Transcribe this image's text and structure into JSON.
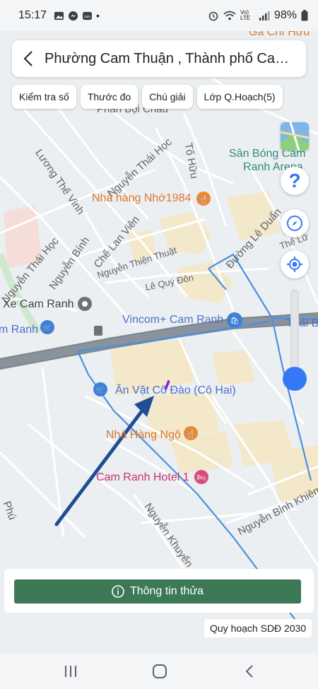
{
  "status_bar": {
    "time": "15:17",
    "battery": "98%",
    "network": "Vo) LTE",
    "icons": [
      "image-icon",
      "messenger-icon",
      "zalo-icon",
      "dot-icon",
      "alarm-icon",
      "wifi-icon",
      "signal-icon",
      "battery-icon"
    ]
  },
  "header": {
    "back_icon": "back-arrow-icon",
    "title": "Phường Cam Thuận , Thành phố Cam Ranh"
  },
  "chips": [
    {
      "label": "Kiểm tra số"
    },
    {
      "label": "Thước đo"
    },
    {
      "label": "Chú giải"
    },
    {
      "label": "Lớp Q.Hoạch(5)"
    }
  ],
  "controls": {
    "layer_icon": "map-layer-icon",
    "help_icon": "help-icon",
    "compass_icon": "compass-icon",
    "locate_icon": "my-location-icon",
    "opacity_slider_value": 0.1
  },
  "map_labels": {
    "ga_chi_huu": "Gà Chí Hữu",
    "phan_boi_chau": "Phan Bội Châu",
    "san_bong": "Sân Bóng Cam",
    "san_bong_2": "Ranh Arena",
    "to_huu": "Tố Hữu",
    "luong_the_vinh": "Lương Thế Vinh",
    "nguyen_thai_hoc_1": "Nguyễn Thái Học",
    "nhahang_nho": "Nhà hàng Nhớ1984",
    "duong_le_duan": "Đường Lê Duẩn",
    "the_lu": "Thế Lữ",
    "che_lan_vien": "Chế Lan Viên",
    "nguyen_binh": "Nguyễn Bính",
    "nguyen_thai_hoc_2": "Nguyễn Thái Học",
    "nguyen_thien_thuat": "Nguyễn Thiện Thuật",
    "le_quy_don": "Lê Quý Đôn",
    "xe_cam_ranh": "Xe Cam Ranh",
    "vincom": "Vincom+ Cam Ranh",
    "thai_bao": "Thái B",
    "cam_ranh_left": "m Ranh",
    "an_vat": "Ăn Vặt Cô Đào (Cô Hai)",
    "nha_hang_ngo": "Nhà Hàng Ngộ",
    "hotel": "Cam Ranh Hotel 1",
    "nguyen_binh_khiem": "Nguyễn Bỉnh Khiêm",
    "nguyen_khuyen": "Nguyễn Khuyến",
    "phu": "Phú"
  },
  "bottom": {
    "info_button": "Thông tin thửa",
    "info_icon": "info-icon",
    "plan_label": "Quy hoạch SDĐ 2030"
  },
  "nav": {
    "items": [
      "recents-icon",
      "home-icon",
      "back-icon"
    ]
  },
  "colors": {
    "accent": "#3478f6",
    "info_button": "#3c7a57",
    "boundary": "#4a90e2",
    "main_road": "#7d8590",
    "arrow": "#1f4e96"
  }
}
